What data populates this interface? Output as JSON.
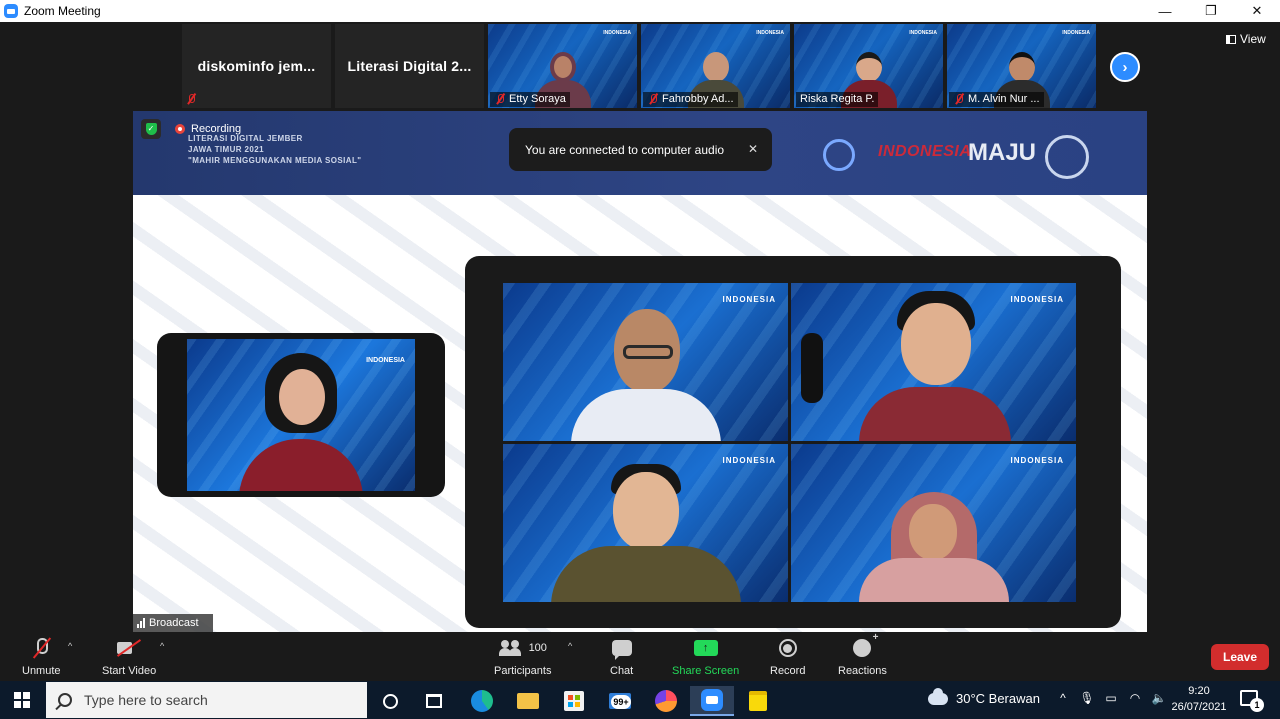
{
  "window": {
    "title": "Zoom Meeting",
    "controls": [
      "—",
      "❐",
      "✕"
    ]
  },
  "gallery": {
    "tiles": [
      {
        "name": "diskominfo  jem...",
        "type": "name-only",
        "muted": true
      },
      {
        "name": "Literasi  Digital  2...",
        "type": "name-only",
        "muted": false
      },
      {
        "name": "Etty Soraya",
        "type": "video",
        "muted": true,
        "body_color": "#6b3b4a"
      },
      {
        "name": "Fahrobby Ad...",
        "type": "video",
        "muted": true,
        "body_color": "#4a4a3a"
      },
      {
        "name": "Riska Regita P.",
        "type": "video",
        "muted": false,
        "body_color": "#7a1f2a"
      },
      {
        "name": "M. Alvin Nur ...",
        "type": "video",
        "muted": true,
        "body_color": "#2c2c2c"
      }
    ],
    "next_icon": "chevron-right-icon",
    "next_symbol": "›",
    "view_label": "View"
  },
  "share": {
    "recording_label": "Recording",
    "banner_text": "You are connected to computer audio",
    "banner_close": "✕",
    "slide_title_lines": [
      "LITERASI DIGITAL JEMBER",
      "JAWA TIMUR 2021",
      "\"MAHIR MENGGUNAKAN MEDIA SOSIAL\""
    ],
    "logo_text_1": "INDONESIA",
    "logo_text_2": "MAJU",
    "watermark": "INDONESIA",
    "broadcast_label": "Broadcast"
  },
  "toolbar": {
    "unmute_label": "Unmute",
    "start_video_label": "Start Video",
    "participants_label": "Participants",
    "participants_count": "100",
    "chat_label": "Chat",
    "share_label": "Share Screen",
    "record_label": "Record",
    "reactions_label": "Reactions",
    "leave_label": "Leave",
    "caret": "^"
  },
  "taskbar": {
    "search_placeholder": "Type here to search",
    "mail_badge": "99+",
    "weather": "30°C  Berawan",
    "tray_icons": [
      "chevron-up-icon",
      "microphone-icon",
      "battery-icon",
      "wifi-icon",
      "speaker-icon"
    ],
    "tray_symbols": [
      "^",
      "🎙",
      "▭",
      "◠",
      "🔈"
    ],
    "time": "9:20",
    "date": "26/07/2021",
    "notification_count": "1"
  }
}
